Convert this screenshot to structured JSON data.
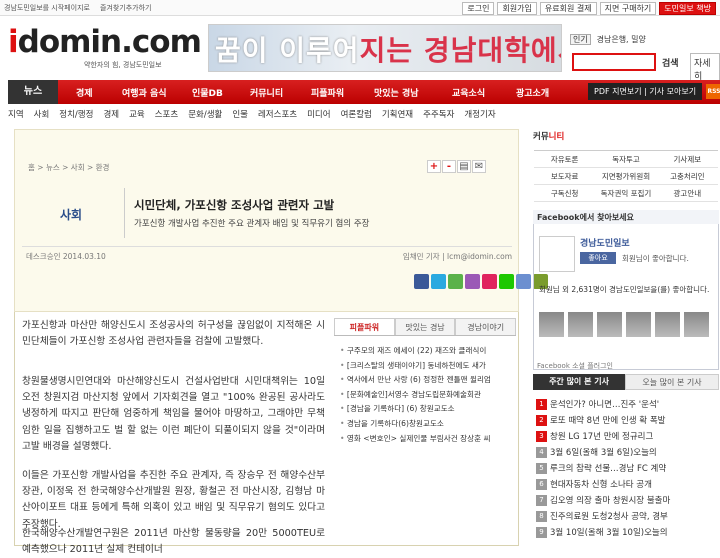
{
  "topbar": {
    "links": [
      "경남도민일보를 시작페이지로",
      "즐겨찾기추가하기"
    ],
    "buttons": [
      "로그인",
      "회원가입",
      "유료회원 결제",
      "지면 구매하기",
      "도민일보 책방"
    ]
  },
  "logo": {
    "brand": "domin.com",
    "brand_i": "i",
    "slogan": "약한자의 힘, 경남도민일보"
  },
  "banner": {
    "text_a": "꿈이 이루어",
    "text_b": "지는 경남대학에서"
  },
  "search": {
    "tag": "인기",
    "keywords": "경남은행, 밀양",
    "button": "검색",
    "detail": "자세히"
  },
  "nav": {
    "home": "뉴스",
    "items": [
      "경제",
      "여행과 음식",
      "인물DB",
      "커뮤니티",
      "피플파워",
      "맛있는 경남",
      "교육소식",
      "광고소개"
    ],
    "pdf": "PDF 지면보기 | 기사 모아보기",
    "rss": "RSS"
  },
  "subnav": [
    "지역",
    "사회",
    "정치/행정",
    "경제",
    "교육",
    "스포츠",
    "문화/생활",
    "인물",
    "레저스포츠",
    "미디어",
    "여론칼럼",
    "기획연재",
    "주주독자",
    "개정기자"
  ],
  "article": {
    "breadcrumb": "홈 > 뉴스 > 사회 > 환경",
    "font_plus": "+",
    "font_minus": "-",
    "section": "사회",
    "headline": "시민단체, 가포신항 조성사업 관련자 고발",
    "subheadline": "가포신항 개발사업 추진한 주요 관계자 배임 및 직무유기 혐의 주장",
    "desk": "데스크승인  2014.03.10",
    "reporter": "임채민 기자 | lcm@idomin.com",
    "paragraphs": [
      "가포신항과 마산만 해양신도시 조성공사의 허구성을 끊임없이 지적해온 시민단체들이 가포신항 조성사업 관련자들을 검찰에 고발했다.",
      "창원물생명시민연대와 마산해양신도시 건설사업반대 시민대책위는 10일 오전 창원지검 마산지청 앞에서 기자회견을 열고 \"100% 완공된 공사라도 냉정하게 따지고 판단해 엄중하게 책임을 물어야 마땅하고, 그래야만 무책임한 일을 집행하고도 벌 할 없는 이런 폐단이 되풀이되지 않을 것\"이라며 고발 배경을 설명했다.",
      "이들은 가포신항 개발사업을 추진한 주요 관계자, 즉 장승우 전 해양수산부 장관, 이정욱 전 한국해양수산개발원 원장, 황철곤 전 마산시장, 김형남 마산아이포트 대표 등에게 특해 의혹이 있고 배임 및 직무유기 혐의도 있다고 주장했다.",
      "한국해양수산개발연구원은 2011년 마산항 물동량을 20만 5000TEU로 예측했으나 2011년 실제 컨테이너"
    ]
  },
  "popular": {
    "tabs": [
      "피플파워",
      "맛있는 경남",
      "경남이야기"
    ],
    "items": [
      "구주모의 재즈 에세이 (22) 재즈와 클래식이",
      "[크리스탈의 생태이야기] 동네하천에도 새가",
      "역사에서 만난 사랑 (6) 정정한 젠틀맨 윌리엄",
      "[문화예술인]서영수 경남도립문화예술회관",
      "[경남을 기록하다] (6) 창원교도소",
      "경남을 기록하다(6)창원교도소",
      "영화 <변호인> 실제인물 부림사건 장상훈 씨"
    ]
  },
  "community": {
    "title": "커뮤",
    "title_red": "니티",
    "items": [
      "자유토론",
      "독자투고",
      "기사제보",
      "보도자료",
      "지면평가위원회",
      "고충처리인",
      "구독신청",
      "독자권익 포집기",
      "광고안내"
    ]
  },
  "facebook": {
    "header": "Facebook에서 찾아보세요",
    "page_name": "경남도민일보",
    "like": "좋아요",
    "like_text": "회원님이 좋아합니다.",
    "count_text": "회원님 외 2,631명이 경남도민일보을(를) 좋아합니다.",
    "footer": "Facebook 소셜 플러그인"
  },
  "mostread": {
    "tabs": [
      "주간 많이 본 기사",
      "오늘 많이 본 기사"
    ],
    "items": [
      "운석인가? 아니면…진주 '운석'",
      "로또 때약 8년 만에 인생 확 폭발",
      "창원 LG 17년 만에 정규리그",
      "3월 6일(올해 3월 6일)오늘의",
      "루크의 참략 선물…경남 FC 계약",
      "현대자동차 신형 소나타 공개",
      "김오영 의장 출마 창원시장 불출마",
      "진주의료원 도청2청사 공약, 경부",
      "3월 10일(올해 3월 10일)오늘의"
    ]
  }
}
